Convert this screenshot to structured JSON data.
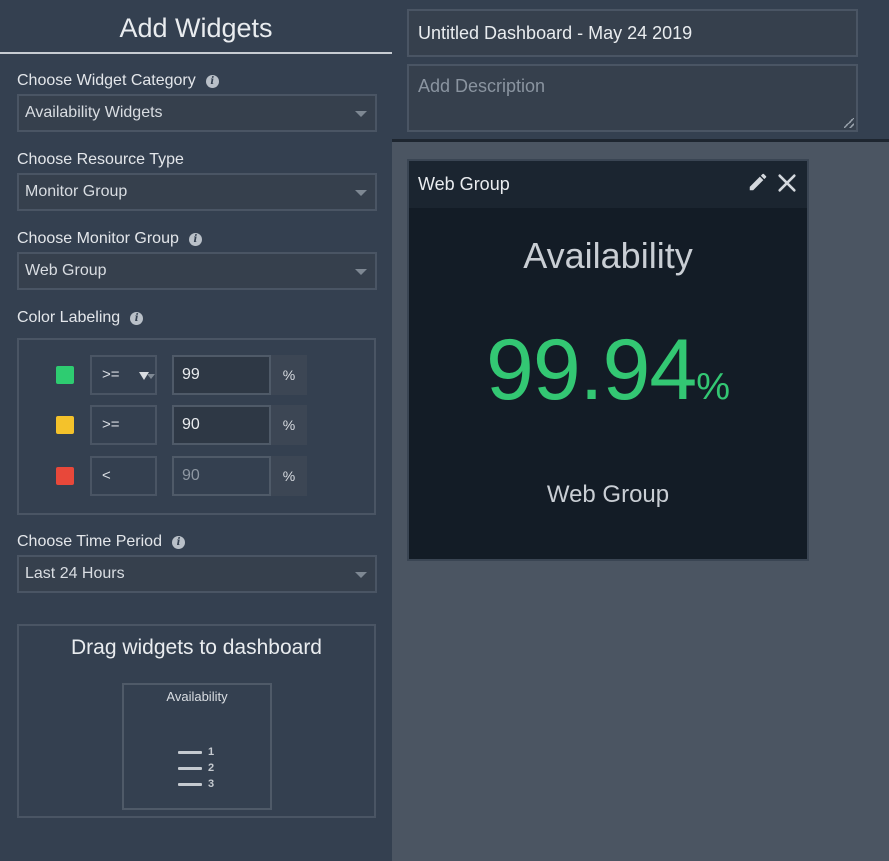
{
  "panel": {
    "title": "Add Widgets",
    "category": {
      "label": "Choose Widget Category",
      "value": "Availability Widgets"
    },
    "resource_type": {
      "label": "Choose Resource Type",
      "value": "Monitor Group"
    },
    "monitor_group": {
      "label": "Choose Monitor Group",
      "value": "Web Group"
    },
    "color_labeling": {
      "label": "Color Labeling",
      "rows": [
        {
          "color": "#2ecc71",
          "operator": ">=",
          "value": "99",
          "unit": "%"
        },
        {
          "color": "#f4c22b",
          "operator": ">=",
          "value": "90",
          "unit": "%"
        },
        {
          "color": "#e8483a",
          "operator": "<",
          "value": "90",
          "unit": "%"
        }
      ]
    },
    "time_period": {
      "label": "Choose Time Period",
      "value": "Last 24 Hours"
    },
    "drag": {
      "title": "Drag widgets to dashboard",
      "tile_title": "Availability",
      "tile_items": [
        "1",
        "2",
        "3"
      ]
    }
  },
  "dashboard": {
    "title": "Untitled Dashboard - May 24 2019",
    "description_placeholder": "Add Description"
  },
  "widget": {
    "header": "Web Group",
    "heading": "Availability",
    "value": "99.94",
    "unit": "%",
    "footer": "Web Group",
    "value_color": "#33c773"
  }
}
